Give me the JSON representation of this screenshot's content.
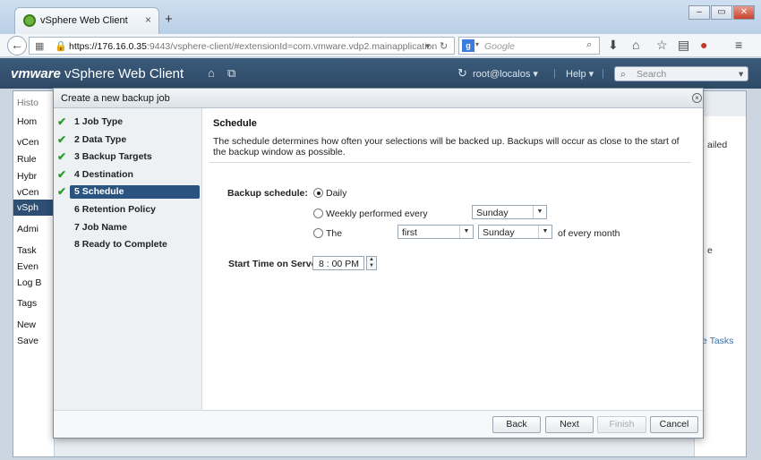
{
  "browser": {
    "tab_title": "vSphere Web Client",
    "tab_close": "×",
    "newtab": "+",
    "window_buttons": [
      "‒",
      "▭",
      "✕"
    ],
    "url_host": "https://176.16.0.35",
    "url_rest": ":9443/vsphere-client/#extensionId=com.vmware.vdp2.mainapplication",
    "search_placeholder": "Google",
    "search_engine_letter": "g"
  },
  "header": {
    "brand_vm": "vmware",
    "brand_name": "vSphere Web Client",
    "user": "root@localos ▾",
    "help": "Help ▾",
    "search_placeholder": "Search"
  },
  "background": {
    "history": "Histo",
    "nav": [
      "Hom",
      "vCen",
      "Rule",
      "Hybr",
      "vCen",
      "vSph",
      "Admi",
      "Task",
      "Even",
      "Log B",
      "Tags",
      "New",
      "Save"
    ],
    "right_text": [
      "ailed",
      "e",
      "e Tasks"
    ]
  },
  "dialog": {
    "title": "Create a new backup job",
    "close": "×",
    "steps": [
      {
        "label": "1  Job Type",
        "done": true
      },
      {
        "label": "2  Data Type",
        "done": true
      },
      {
        "label": "3  Backup Targets",
        "done": true
      },
      {
        "label": "4  Destination",
        "done": true
      },
      {
        "label": "5  Schedule",
        "done": true,
        "selected": true
      },
      {
        "label": "6  Retention Policy",
        "done": false
      },
      {
        "label": "7  Job Name",
        "done": false
      },
      {
        "label": "8  Ready to Complete",
        "done": false
      }
    ],
    "schedule": {
      "title": "Schedule",
      "description": "The schedule determines how often your selections will be backed up.  Backups will occur as close to the start of the backup window as possible.",
      "backup_schedule_label": "Backup schedule:",
      "option_daily": "Daily",
      "option_weekly": "Weekly performed every",
      "weekly_day": "Sunday",
      "option_the": "The",
      "the_ordinal": "first",
      "the_day": "Sunday",
      "of_every_month": "of every month",
      "start_time_label": "Start Time on Server:",
      "start_time": "8 : 00 PM"
    },
    "buttons": {
      "back": "Back",
      "next": "Next",
      "finish": "Finish",
      "cancel": "Cancel"
    }
  }
}
